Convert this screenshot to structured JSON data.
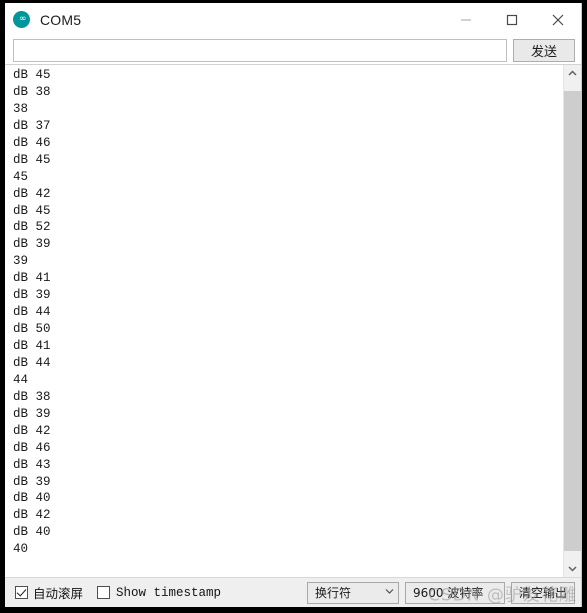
{
  "window": {
    "title": "COM5",
    "app_icon": "arduino-logo-icon",
    "controls": {
      "minimize": "minimize-icon",
      "maximize": "maximize-icon",
      "close": "close-icon"
    }
  },
  "send_bar": {
    "input_value": "",
    "input_placeholder": "",
    "send_label": "发送"
  },
  "console": {
    "lines": [
      "dB 45",
      "dB 38",
      "38",
      "dB 37",
      "dB 46",
      "dB 45",
      "45",
      "dB 42",
      "dB 45",
      "dB 52",
      "dB 39",
      "39",
      "dB 41",
      "dB 39",
      "dB 44",
      "dB 50",
      "dB 41",
      "dB 44",
      "44",
      "dB 38",
      "dB 39",
      "dB 42",
      "dB 46",
      "dB 43",
      "dB 39",
      "dB 40",
      "dB 42",
      "dB 40",
      "40"
    ]
  },
  "scrollbar": {
    "up_arrow": "chevron-up-icon",
    "down_arrow": "chevron-down-icon"
  },
  "status_bar": {
    "autoscroll_label": "自动滚屏",
    "autoscroll_checked": true,
    "timestamp_label": "Show timestamp",
    "timestamp_checked": false,
    "line_ending_value": "换行符",
    "baud_value": "9600 波特率",
    "clear_label": "清空输出",
    "caret_icon": "chevron-down-icon"
  },
  "watermark": {
    "text": "CSDN @驴友花雕"
  }
}
